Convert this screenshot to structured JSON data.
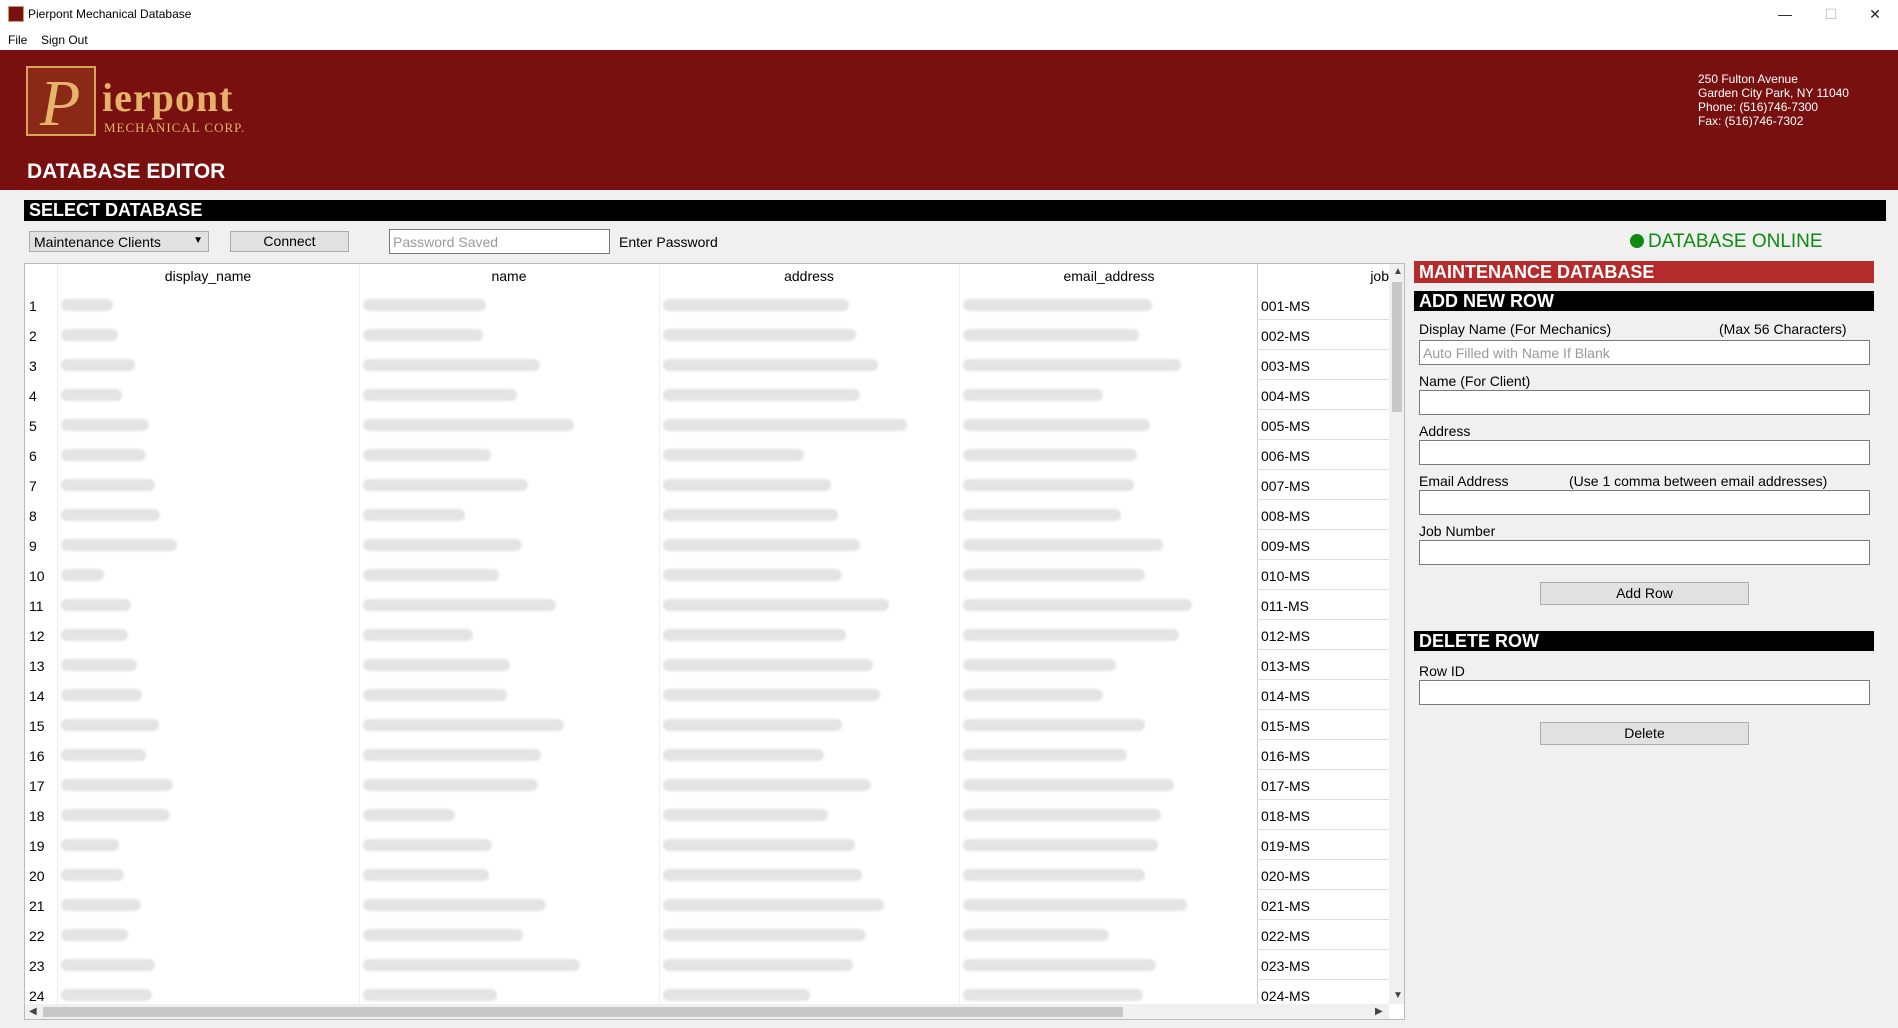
{
  "window": {
    "title": "Pierpont Mechanical Database",
    "minimize": "—",
    "maximize": "☐",
    "close": "✕"
  },
  "menu": {
    "file": "File",
    "sign_out": "Sign Out"
  },
  "banner": {
    "logo_letter": "P",
    "logo_text": "ierpont",
    "logo_sub": "MECHANICAL CORP.",
    "editor_title": "DATABASE EDITOR",
    "address_line1": "250 Fulton Avenue",
    "address_line2": "Garden City Park, NY 11040",
    "phone": "Phone: (516)746-7300",
    "fax": "Fax: (516)746-7302"
  },
  "select_database": {
    "header": "SELECT DATABASE",
    "selected": "Maintenance Clients",
    "connect_label": "Connect",
    "password_placeholder": "Password Saved",
    "password_label": "Enter Password",
    "status": "DATABASE ONLINE",
    "status_color": "#108a10"
  },
  "table": {
    "columns": [
      "display_name",
      "name",
      "address",
      "email_address",
      "job"
    ],
    "rows": [
      {
        "id": "1",
        "job": "001-MS"
      },
      {
        "id": "2",
        "job": "002-MS"
      },
      {
        "id": "3",
        "job": "003-MS"
      },
      {
        "id": "4",
        "job": "004-MS"
      },
      {
        "id": "5",
        "job": "005-MS"
      },
      {
        "id": "6",
        "job": "006-MS"
      },
      {
        "id": "7",
        "job": "007-MS"
      },
      {
        "id": "8",
        "job": "008-MS"
      },
      {
        "id": "9",
        "job": "009-MS"
      },
      {
        "id": "10",
        "job": "010-MS"
      },
      {
        "id": "11",
        "job": "011-MS"
      },
      {
        "id": "12",
        "job": "012-MS"
      },
      {
        "id": "13",
        "job": "013-MS"
      },
      {
        "id": "14",
        "job": "014-MS"
      },
      {
        "id": "15",
        "job": "015-MS"
      },
      {
        "id": "16",
        "job": "016-MS"
      },
      {
        "id": "17",
        "job": "017-MS"
      },
      {
        "id": "18",
        "job": "018-MS"
      },
      {
        "id": "19",
        "job": "019-MS"
      },
      {
        "id": "20",
        "job": "020-MS"
      },
      {
        "id": "21",
        "job": "021-MS"
      },
      {
        "id": "22",
        "job": "022-MS"
      },
      {
        "id": "23",
        "job": "023-MS"
      },
      {
        "id": "24",
        "job": "024-MS"
      }
    ]
  },
  "maintenance": {
    "header": "MAINTENANCE DATABASE",
    "add_header": "ADD NEW ROW",
    "display_name_label": "Display Name (For Mechanics)",
    "display_name_hint": "(Max 56 Characters)",
    "display_name_placeholder": "Auto Filled with Name If Blank",
    "name_label": "Name (For Client)",
    "address_label": "Address",
    "email_label": "Email Address",
    "email_hint": "(Use 1 comma between email addresses)",
    "job_label": "Job Number",
    "add_button": "Add Row",
    "delete_header": "DELETE  ROW",
    "row_id_label": "Row ID",
    "delete_button": "Delete"
  }
}
